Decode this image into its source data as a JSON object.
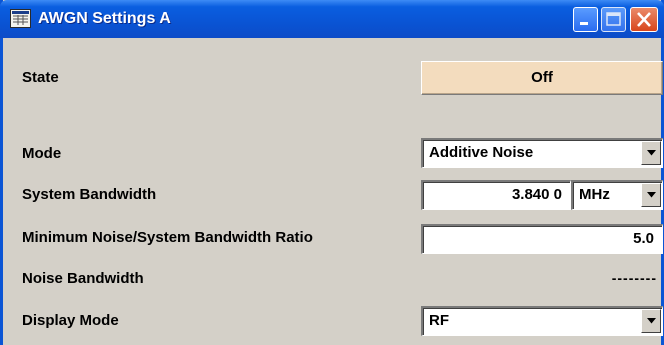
{
  "window": {
    "title": "AWGN Settings A"
  },
  "colors": {
    "titlebar": "#0a54d4",
    "window_bg": "#d4d0c8",
    "state_button_bg": "#f3dcbe"
  },
  "icons": {
    "app": "table-window-icon",
    "minimize": "minimize-icon",
    "maximize": "maximize-icon",
    "close": "close-icon",
    "dropdown": "chevron-down-icon"
  },
  "settings": {
    "state": {
      "label": "State",
      "value": "Off"
    },
    "mode": {
      "label": "Mode",
      "value": "Additive Noise"
    },
    "system_bandwidth": {
      "label": "System Bandwidth",
      "value": "3.840 0",
      "unit": "MHz"
    },
    "min_noise_ratio": {
      "label": "Minimum Noise/System Bandwidth Ratio",
      "value": "5.0"
    },
    "noise_bandwidth": {
      "label": "Noise Bandwidth",
      "value": "--------"
    },
    "display_mode": {
      "label": "Display Mode",
      "value": "RF"
    }
  }
}
